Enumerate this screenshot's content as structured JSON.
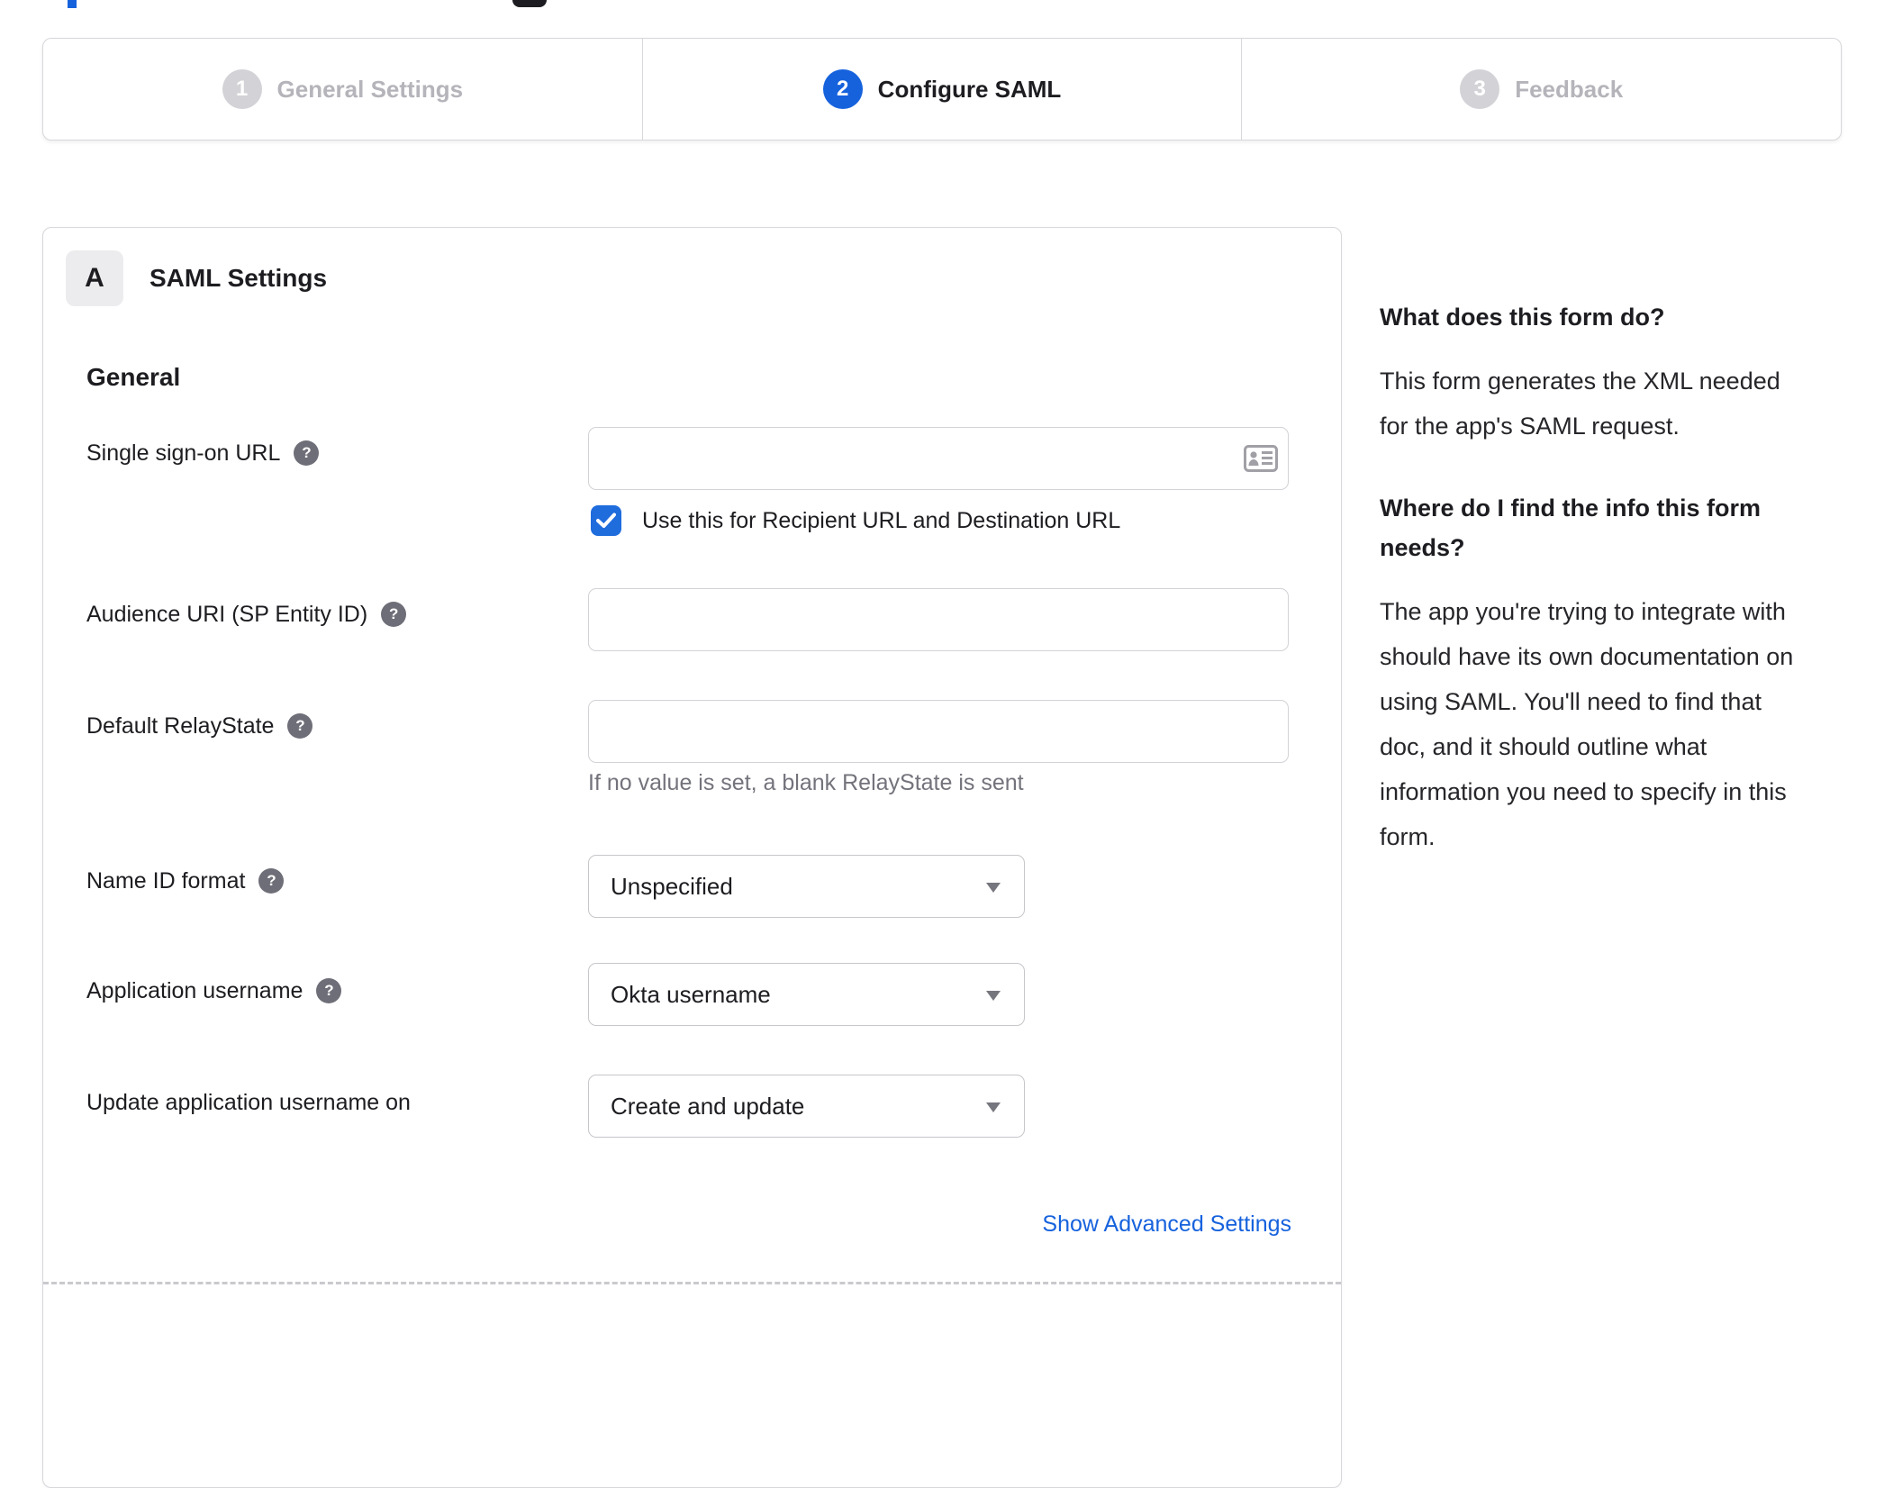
{
  "colors": {
    "accent": "#1662dd",
    "step_inactive": "#d2d2d7",
    "border": "#d7d7dc",
    "hint_text": "#73737c"
  },
  "icons": {
    "help_glyph": "?"
  },
  "stepper": {
    "steps": [
      {
        "number": "1",
        "label": "General Settings",
        "state": "inactive"
      },
      {
        "number": "2",
        "label": "Configure SAML",
        "state": "active"
      },
      {
        "number": "3",
        "label": "Feedback",
        "state": "inactive"
      }
    ]
  },
  "panel": {
    "badge": "A",
    "title": "SAML Settings",
    "heading": "General",
    "sso": {
      "label": "Single sign-on URL",
      "value": "",
      "checkbox_label": "Use this for Recipient URL and Destination URL",
      "checked": true
    },
    "audience": {
      "label": "Audience URI (SP Entity ID)",
      "value": ""
    },
    "relay": {
      "label": "Default RelayState",
      "value": "",
      "hint": "If no value is set, a blank RelayState is sent"
    },
    "name_id": {
      "label": "Name ID format",
      "value": "Unspecified"
    },
    "app_username": {
      "label": "Application username",
      "value": "Okta username"
    },
    "update_username": {
      "label": "Update application username on",
      "value": "Create and update"
    },
    "advanced_link": "Show Advanced Settings"
  },
  "sidebar": {
    "q1": "What does this form do?",
    "a1": "This form generates the XML needed\nfor the app's SAML request.",
    "q2": "Where do I find the info this form\nneeds?",
    "a2": "The app you're trying to integrate with\nshould have its own documentation on\nusing SAML. You'll need to find that\ndoc, and it should outline what\ninformation you need to specify in this\nform."
  }
}
